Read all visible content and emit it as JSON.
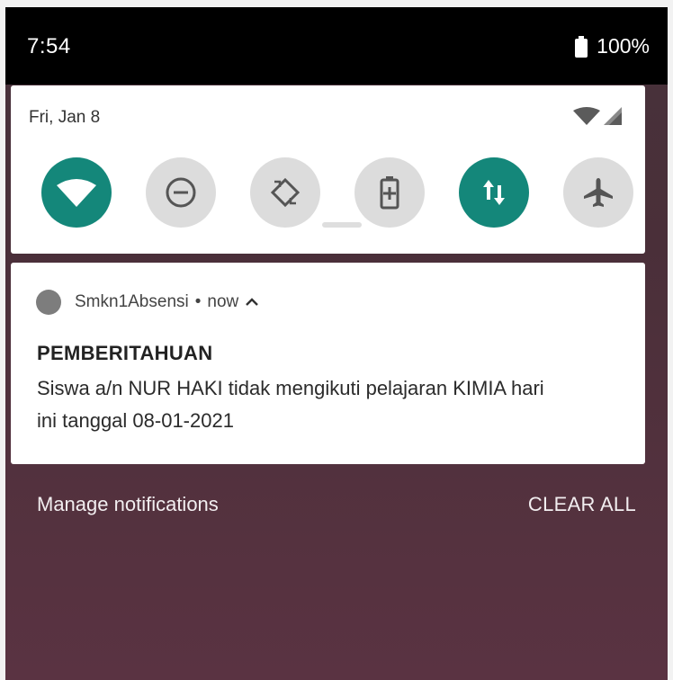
{
  "status_bar": {
    "time": "7:54",
    "battery_percent": "100%",
    "battery_icon": "battery-full-icon"
  },
  "quick_settings": {
    "date": "Fri, Jan 8",
    "signal_icons": [
      "wifi-signal-icon",
      "cellular-signal-icon"
    ],
    "tiles": [
      {
        "name": "wifi",
        "icon": "wifi-icon",
        "state": "on"
      },
      {
        "name": "do-not-disturb",
        "icon": "do-not-disturb-icon",
        "state": "off"
      },
      {
        "name": "auto-rotate",
        "icon": "auto-rotate-icon",
        "state": "off"
      },
      {
        "name": "battery-saver",
        "icon": "battery-saver-icon",
        "state": "off"
      },
      {
        "name": "mobile-data",
        "icon": "mobile-data-icon",
        "state": "on"
      },
      {
        "name": "airplane-mode",
        "icon": "airplane-icon",
        "state": "off"
      }
    ],
    "active_color": "#14877a",
    "inactive_color": "#dcdcdc"
  },
  "notification": {
    "app_name": "Smkn1Absensi",
    "separator": "•",
    "time": "now",
    "expand_icon": "chevron-up-icon",
    "title": "PEMBERITAHUAN",
    "text_line1": "Siswa a/n NUR HAKI tidak mengikuti pelajaran KIMIA hari",
    "text_line2": "ini tanggal 08-01-2021"
  },
  "footer": {
    "manage_label": "Manage notifications",
    "clear_label": "CLEAR ALL"
  }
}
